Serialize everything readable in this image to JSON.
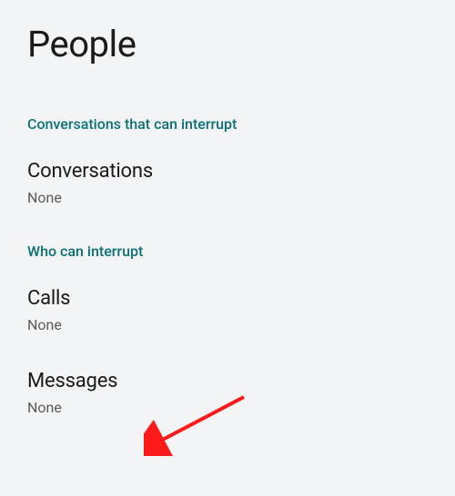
{
  "page": {
    "title": "People"
  },
  "sections": {
    "conversations": {
      "header": "Conversations that can interrupt",
      "items": {
        "conversations": {
          "title": "Conversations",
          "value": "None"
        }
      }
    },
    "interrupt": {
      "header": "Who can interrupt",
      "items": {
        "calls": {
          "title": "Calls",
          "value": "None"
        },
        "messages": {
          "title": "Messages",
          "value": "None"
        }
      }
    }
  }
}
